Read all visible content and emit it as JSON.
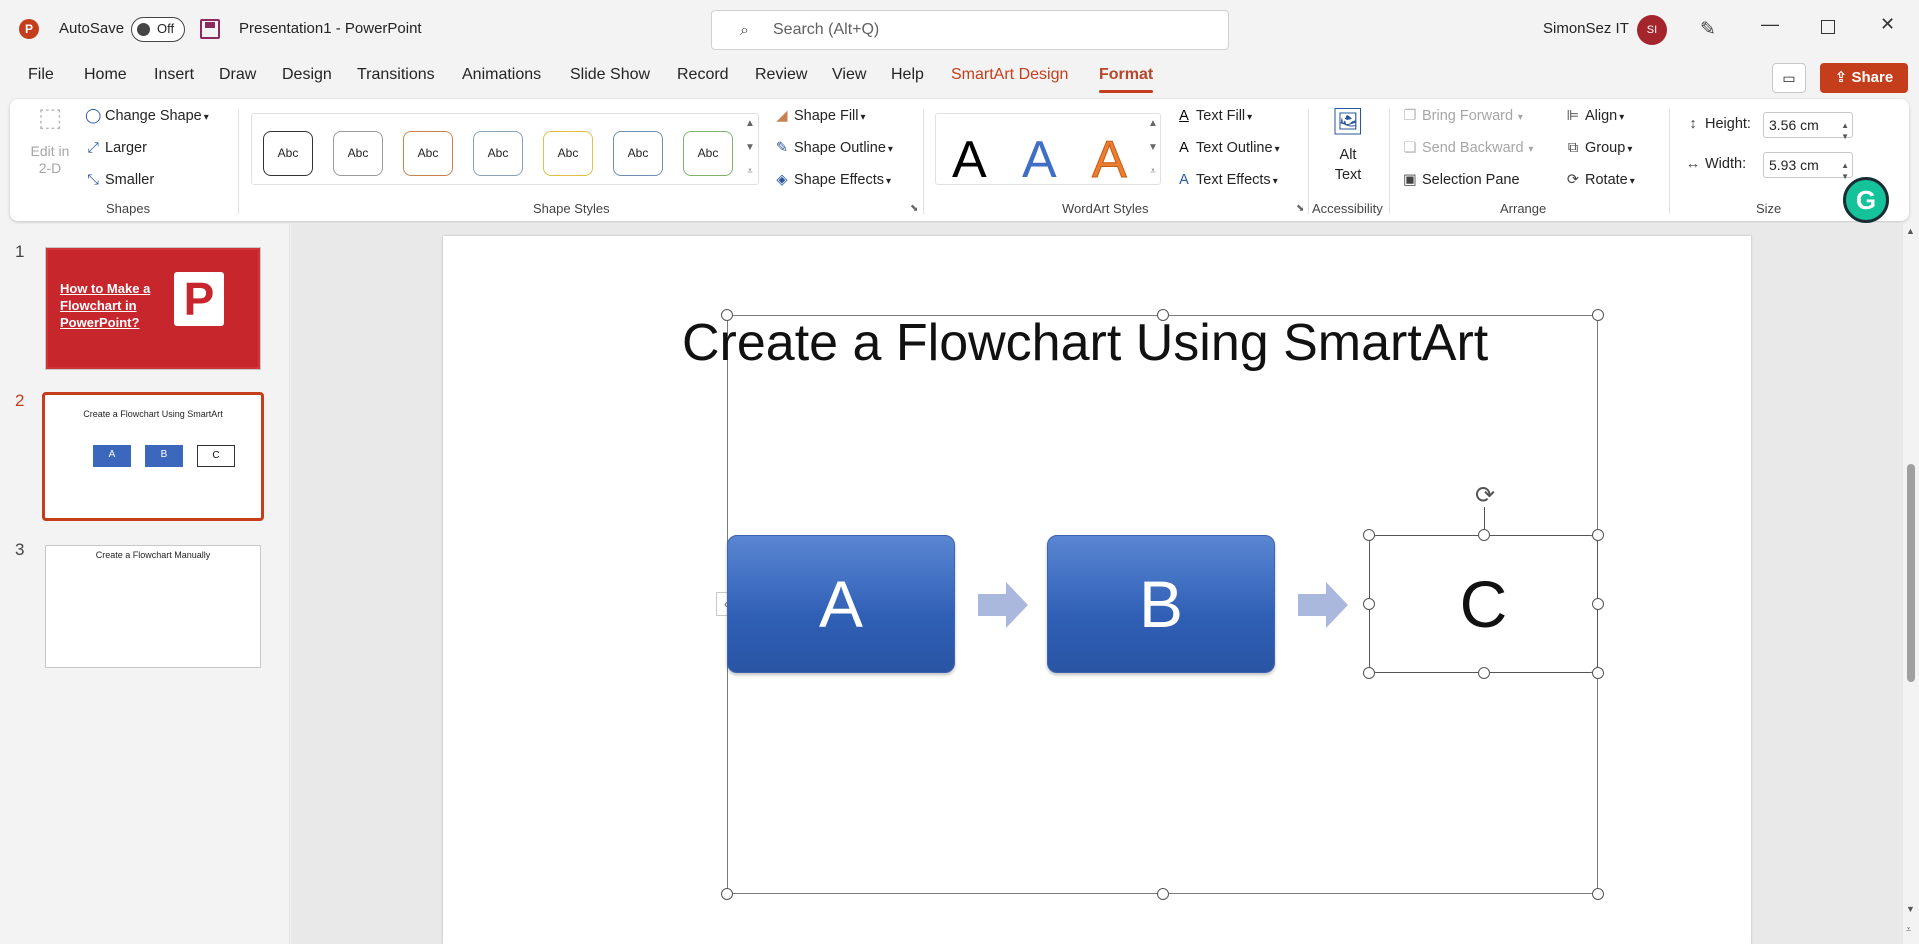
{
  "titlebar": {
    "app_icon": "P",
    "autosave_label": "AutoSave",
    "autosave_state": "Off",
    "doc_title": "Presentation1  -  PowerPoint",
    "search_placeholder": "Search (Alt+Q)",
    "user_name": "SimonSez IT",
    "avatar_initials": "SI",
    "window_controls": [
      "minimize",
      "restore",
      "close"
    ]
  },
  "tabs": [
    "File",
    "Home",
    "Insert",
    "Draw",
    "Design",
    "Transitions",
    "Animations",
    "Slide Show",
    "Record",
    "Review",
    "View",
    "Help",
    "SmartArt Design",
    "Format"
  ],
  "active_tab": "Format",
  "share_label": "Share",
  "ribbon": {
    "shapes": {
      "edit2d": "Edit in 2-D",
      "change_shape": "Change Shape",
      "larger": "Larger",
      "smaller": "Smaller",
      "label": "Shapes"
    },
    "shape_styles": {
      "swatches": [
        "Abc",
        "Abc",
        "Abc",
        "Abc",
        "Abc",
        "Abc",
        "Abc"
      ],
      "swatch_colors": [
        "#333333",
        "#8a8a8a",
        "#c9824f",
        "#8aa2b8",
        "#e3c04a",
        "#6f8fb5",
        "#7fb36a"
      ],
      "shape_fill": "Shape Fill",
      "shape_outline": "Shape Outline",
      "shape_effects": "Shape Effects",
      "label": "Shape Styles"
    },
    "wordart": {
      "letters": [
        "A",
        "A",
        "A"
      ],
      "text_fill": "Text Fill",
      "text_outline": "Text Outline",
      "text_effects": "Text Effects",
      "label": "WordArt Styles"
    },
    "accessibility": {
      "alt_text": "Alt Text",
      "label": "Accessibility"
    },
    "arrange": {
      "bring_forward": "Bring Forward",
      "send_backward": "Send Backward",
      "selection_pane": "Selection Pane",
      "align": "Align",
      "group": "Group",
      "rotate": "Rotate",
      "label": "Arrange"
    },
    "size": {
      "height_label": "Height:",
      "height_value": "3.56 cm",
      "width_label": "Width:",
      "width_value": "5.93 cm",
      "label": "Size"
    }
  },
  "slides": [
    {
      "num": "1",
      "title": "How to Make a Flowchart in PowerPoint?"
    },
    {
      "num": "2",
      "title": "Create a Flowchart Using SmartArt",
      "boxes": [
        "A",
        "B",
        "C"
      ]
    },
    {
      "num": "3",
      "title": "Create a Flowchart Manually"
    }
  ],
  "current_slide": "2",
  "slide": {
    "title": "Create a Flowchart Using SmartArt",
    "boxes": [
      "A",
      "B",
      "C"
    ],
    "collapse_glyph": "‹"
  }
}
